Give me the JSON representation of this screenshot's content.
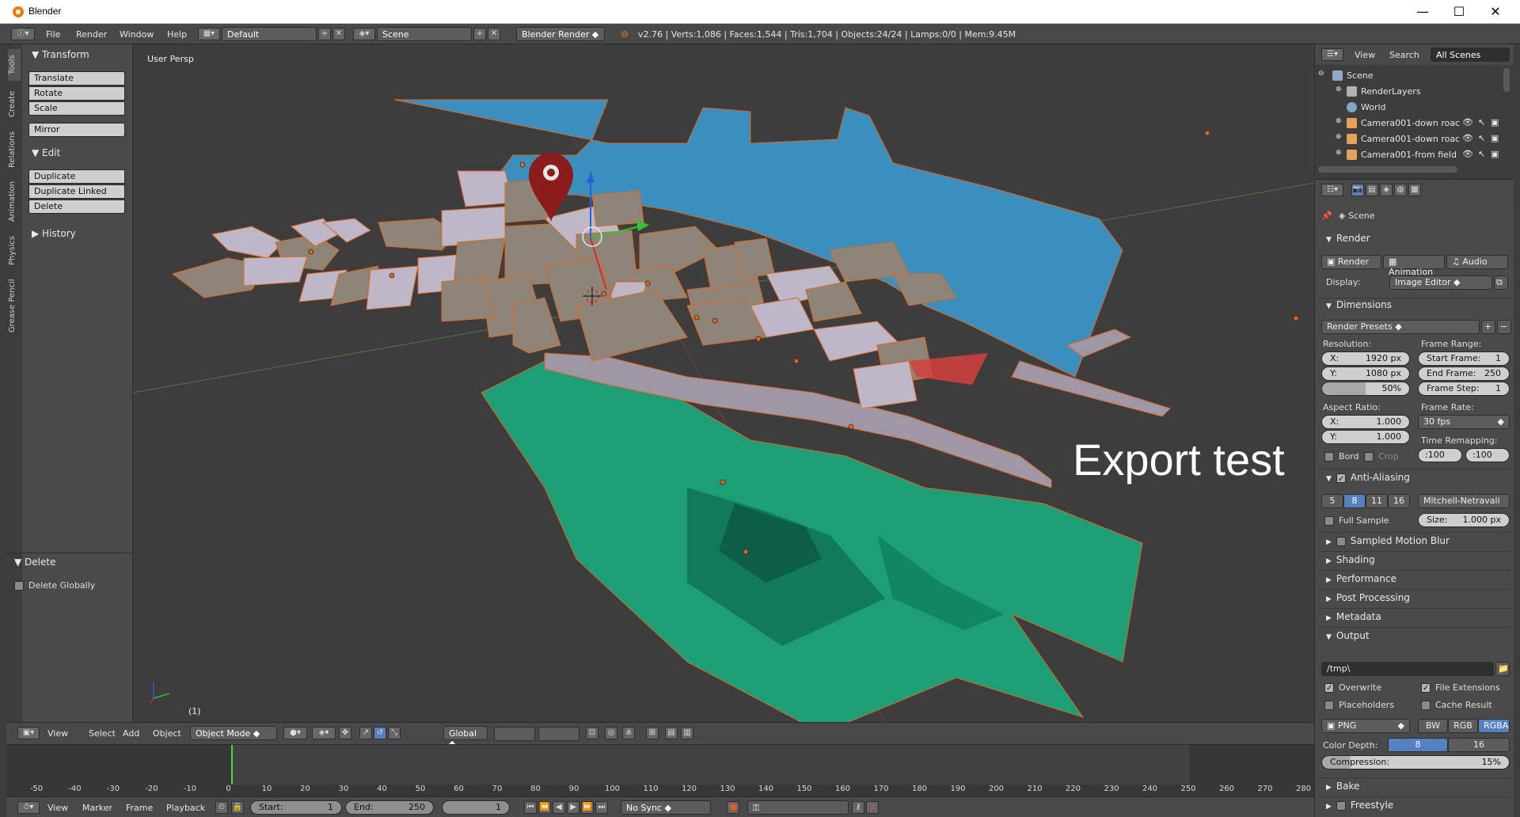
{
  "window": {
    "title": "Blender",
    "minimize": "—",
    "maximize": "☐",
    "close": "✕"
  },
  "topbar": {
    "menus": [
      "File",
      "Render",
      "Window",
      "Help"
    ],
    "layout": "Default",
    "scene": "Scene",
    "engine": "Blender Render",
    "stats": "v2.76 | Verts:1,086 | Faces:1,544 | Tris:1,704 | Objects:24/24 | Lamps:0/0 | Mem:9.45M"
  },
  "toolshelf": {
    "tabs": [
      "Tools",
      "Create",
      "Relations",
      "Animation",
      "Physics",
      "Grease Pencil"
    ],
    "transform": {
      "title": "Transform",
      "buttons": [
        "Translate",
        "Rotate",
        "Scale",
        "Mirror"
      ]
    },
    "edit": {
      "title": "Edit",
      "buttons": [
        "Duplicate",
        "Duplicate Linked",
        "Delete"
      ]
    },
    "history": {
      "title": "History"
    },
    "operator": {
      "title": "Delete",
      "option": "Delete Globally"
    }
  },
  "viewport": {
    "label": "User Persp",
    "frame_label": "(1)",
    "overlay_text": "Export test",
    "colors": {
      "water": "#3b8fbf",
      "ground": "#1c9e76",
      "building_side": "#8f8478",
      "building_top": "#bdb7c9",
      "outline": "#e1661e"
    }
  },
  "vp_header": {
    "menus": [
      "View",
      "Select",
      "Add",
      "Object"
    ],
    "mode": "Object Mode",
    "orientation": "Global"
  },
  "timeline": {
    "ticks": [
      "-50",
      "-40",
      "-30",
      "-20",
      "-10",
      "0",
      "10",
      "20",
      "30",
      "40",
      "50",
      "60",
      "70",
      "80",
      "90",
      "100",
      "110",
      "120",
      "130",
      "140",
      "150",
      "160",
      "170",
      "180",
      "190",
      "200",
      "210",
      "220",
      "230",
      "240",
      "250",
      "260",
      "270",
      "280"
    ],
    "current_frame": 1,
    "range_end": 250,
    "menus": [
      "View",
      "Marker",
      "Frame",
      "Playback"
    ],
    "start_label": "Start:",
    "start_value": "1",
    "end_label": "End:",
    "end_value": "250",
    "current_value": "1",
    "sync": "No Sync"
  },
  "outliner": {
    "menus": [
      "View",
      "Search"
    ],
    "filter": "All Scenes",
    "items": [
      {
        "label": "Scene",
        "level": 0,
        "icon": "scene-icon"
      },
      {
        "label": "RenderLayers",
        "level": 1,
        "icon": "render-layers-icon"
      },
      {
        "label": "World",
        "level": 1,
        "icon": "world-icon"
      },
      {
        "label": "Camera001-down roac",
        "level": 1,
        "icon": "camera-icon"
      },
      {
        "label": "Camera001-down roac",
        "level": 1,
        "icon": "camera-icon"
      },
      {
        "label": "Camera001-from field",
        "level": 1,
        "icon": "camera-icon"
      }
    ]
  },
  "properties": {
    "context": "Scene",
    "render": {
      "title": "Render",
      "buttons": [
        "Render",
        "Animation",
        "Audio"
      ],
      "display_label": "Display:",
      "display_value": "Image Editor"
    },
    "dimensions": {
      "title": "Dimensions",
      "presets": "Render Presets",
      "resolution_label": "Resolution:",
      "res_x": "X:",
      "res_x_val": "1920 px",
      "res_y": "Y:",
      "res_y_val": "1080 px",
      "res_pct": "50%",
      "aspect_label": "Aspect Ratio:",
      "asp_x": "X:",
      "asp_x_val": "1.000",
      "asp_y": "Y:",
      "asp_y_val": "1.000",
      "bord": "Bord",
      "crop": "Crop",
      "frame_range_label": "Frame Range:",
      "start_frame": "Start Frame:",
      "start_frame_val": "1",
      "end_frame": "End Frame:",
      "end_frame_val": "250",
      "frame_step": "Frame Step:",
      "frame_step_val": "1",
      "frame_rate_label": "Frame Rate:",
      "frame_rate": "30 fps",
      "time_remap_label": "Time Remapping:",
      "remap_old": ":100",
      "remap_new": ":100"
    },
    "antialiasing": {
      "title": "Anti-Aliasing",
      "samples": [
        "5",
        "8",
        "11",
        "16"
      ],
      "selected": "8",
      "filter": "Mitchell-Netravali",
      "full_sample": "Full Sample",
      "size_label": "Size:",
      "size_val": "1.000 px"
    },
    "collapsed": [
      "Sampled Motion Blur",
      "Shading",
      "Performance",
      "Post Processing",
      "Metadata"
    ],
    "output": {
      "title": "Output",
      "path": "/tmp\\",
      "overwrite": "Overwrite",
      "file_ext": "File Extensions",
      "placeholders": "Placeholders",
      "cache": "Cache Result",
      "format": "PNG",
      "modes": [
        "BW",
        "RGB",
        "RGBA"
      ],
      "selected_mode": "RGBA",
      "depth_label": "Color Depth:",
      "depths": [
        "8",
        "16"
      ],
      "selected_depth": "8",
      "compression": "Compression:",
      "compression_val": "15%"
    },
    "bake": "Bake",
    "freestyle": "Freestyle"
  }
}
